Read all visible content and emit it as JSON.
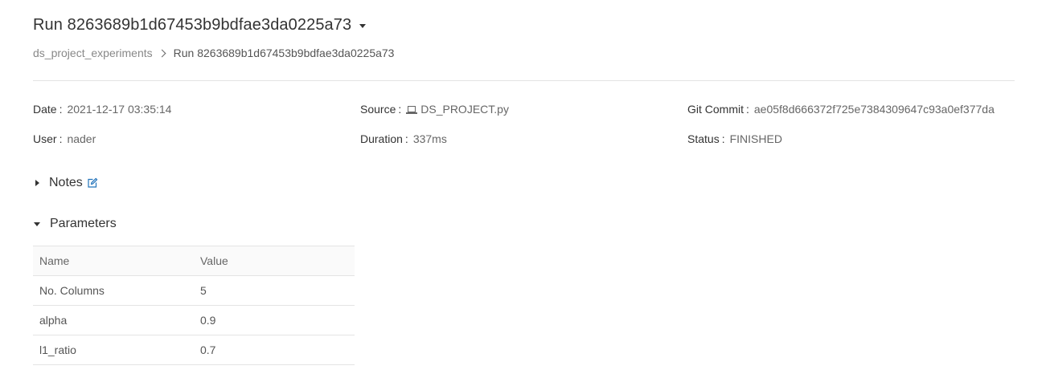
{
  "header": {
    "run_title": "Run 8263689b1d67453b9bdfae3da0225a73"
  },
  "breadcrumb": {
    "experiment": "ds_project_experiments",
    "current": "Run 8263689b1d67453b9bdfae3da0225a73"
  },
  "metadata": {
    "date_label": "Date",
    "date_value": "2021-12-17 03:35:14",
    "source_label": "Source",
    "source_value": "DS_PROJECT.py",
    "git_label": "Git Commit",
    "git_value": "ae05f8d666372f725e7384309647c93a0ef377da",
    "user_label": "User",
    "user_value": "nader",
    "duration_label": "Duration",
    "duration_value": "337ms",
    "status_label": "Status",
    "status_value": "FINISHED"
  },
  "sections": {
    "notes_label": "Notes",
    "parameters_label": "Parameters"
  },
  "parameters": {
    "columns": [
      "Name",
      "Value"
    ],
    "rows": [
      [
        "No. Columns",
        "5"
      ],
      [
        "alpha",
        "0.9"
      ],
      [
        "l1_ratio",
        "0.7"
      ]
    ]
  },
  "colors": {
    "accent": "#2374bb",
    "divider": "#e4e4e4",
    "table_header_bg": "#fafafa"
  },
  "icons": {
    "title_dropdown": "caret-down-icon",
    "breadcrumb_separator": "chevron-right-icon",
    "source": "laptop-icon",
    "notes_toggle": "caret-right-icon",
    "notes_edit": "edit-icon",
    "parameters_toggle": "caret-down-icon"
  }
}
